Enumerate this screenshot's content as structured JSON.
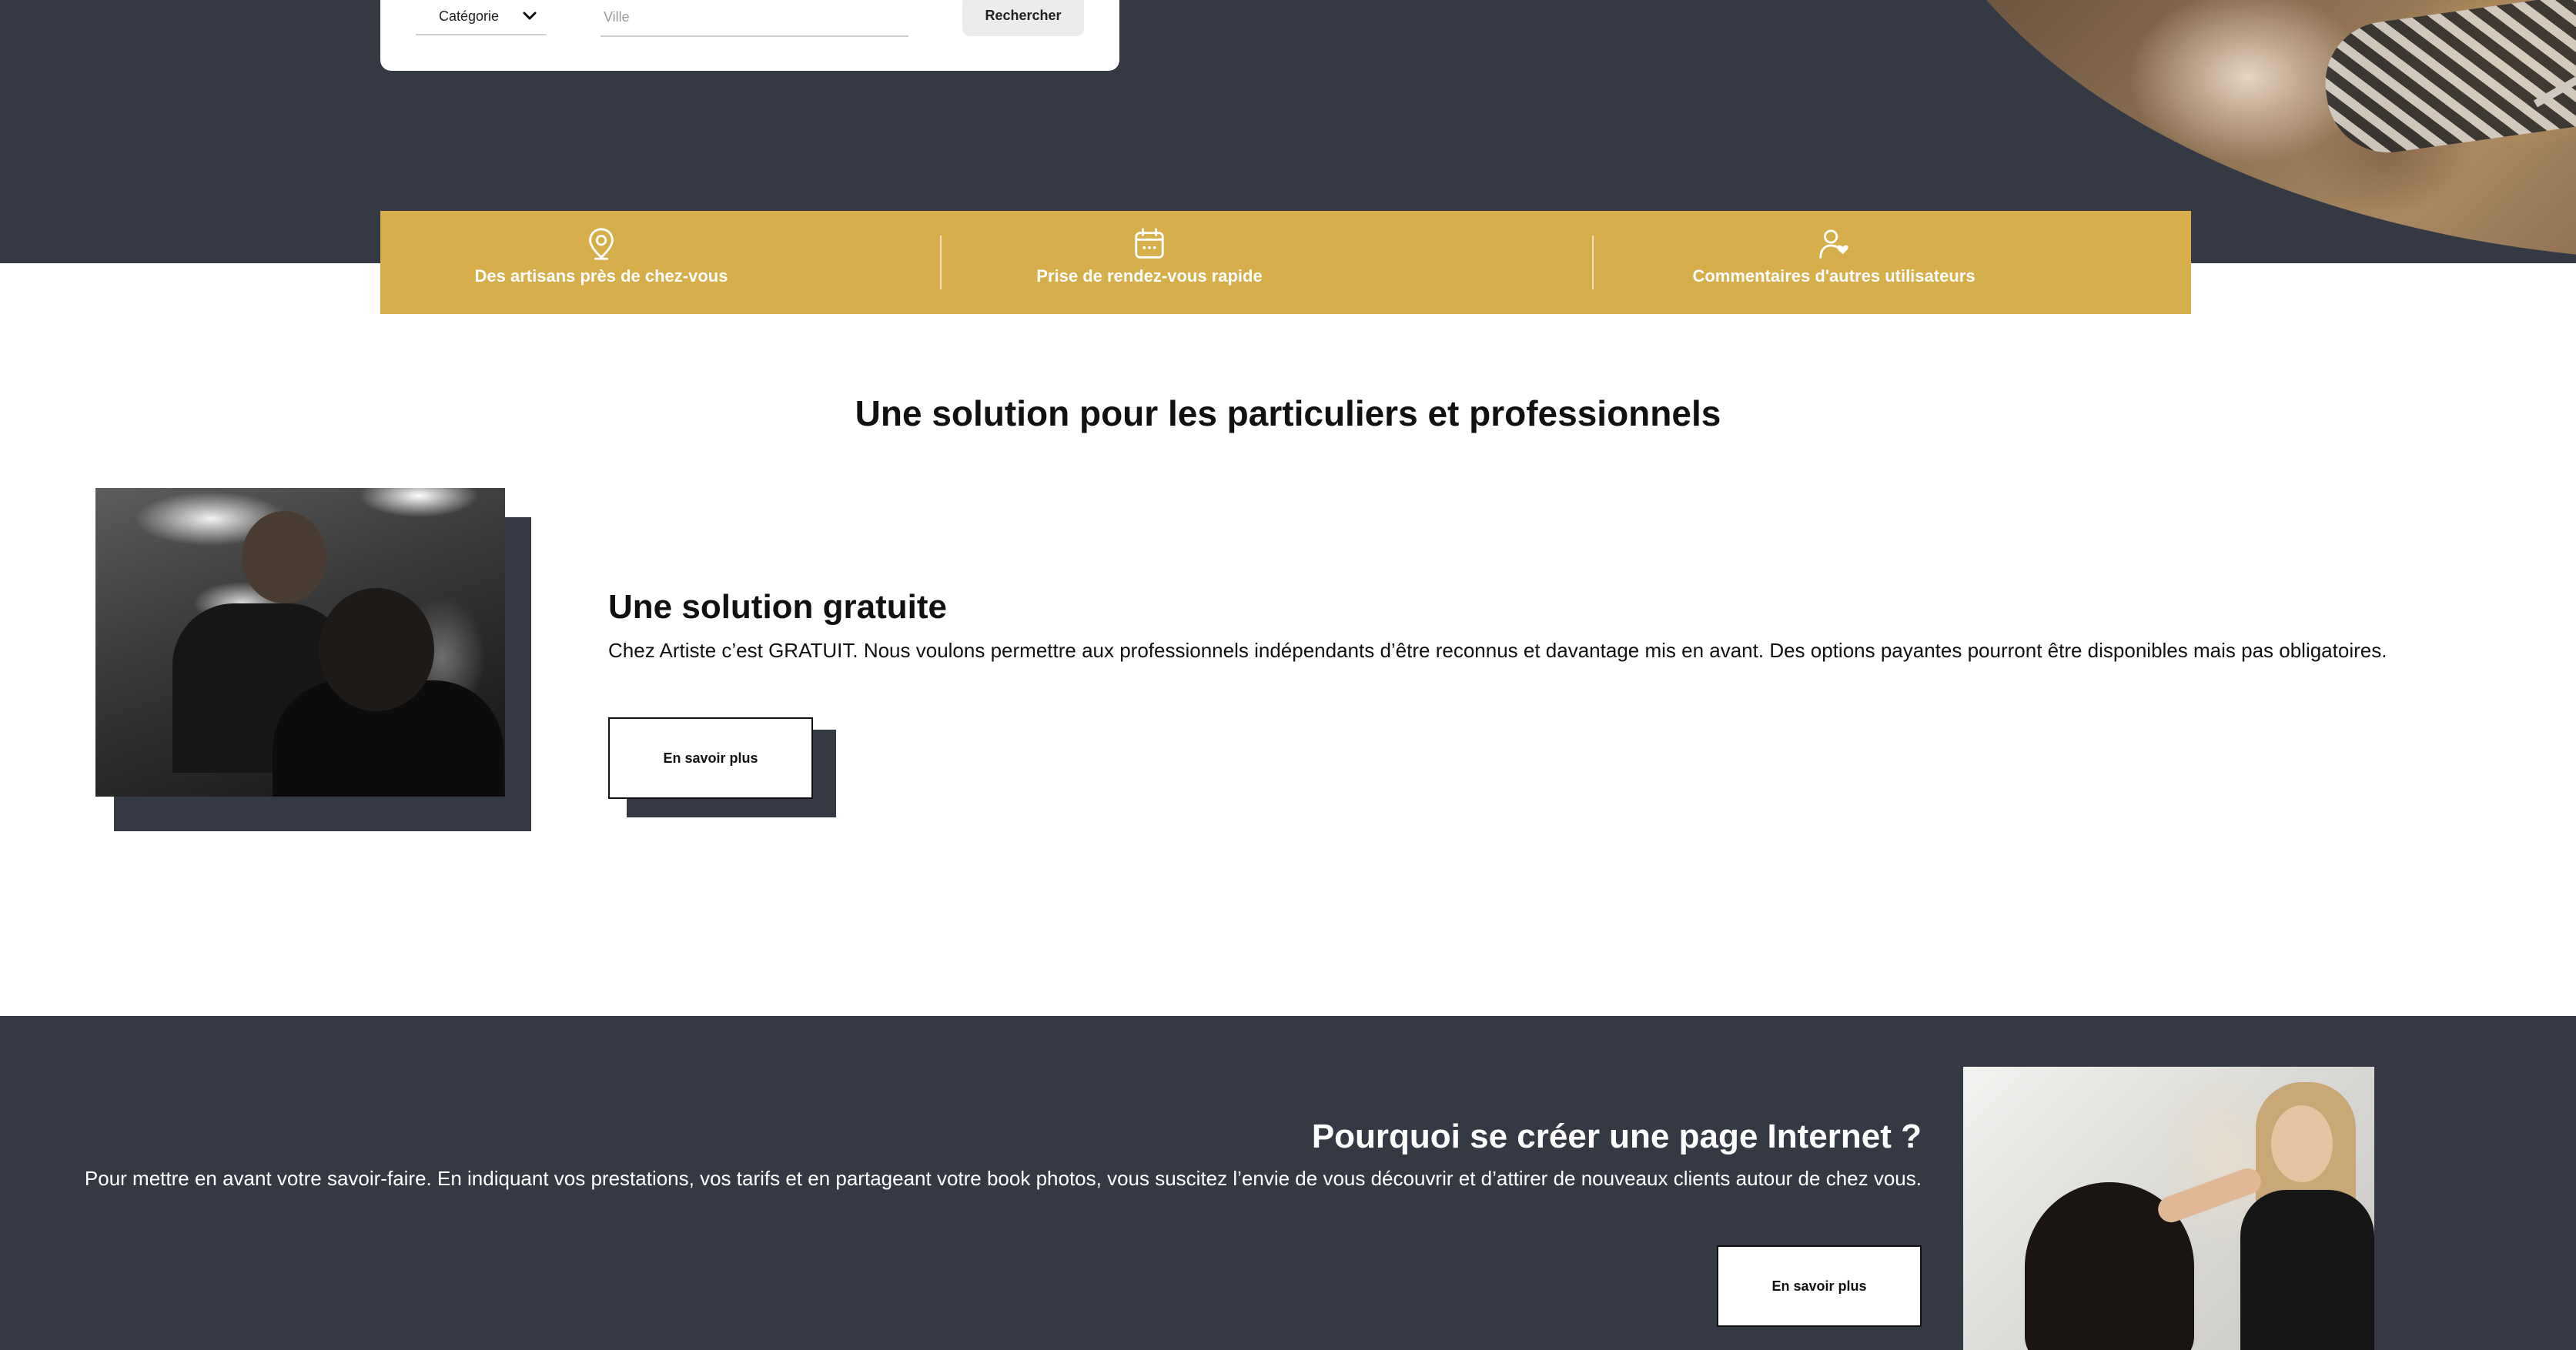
{
  "search": {
    "category_label": "Catégorie",
    "city_placeholder": "Ville",
    "submit_label": "Rechercher"
  },
  "features": [
    {
      "icon": "location-pin-icon",
      "label": "Des artisans près de chez-vous"
    },
    {
      "icon": "calendar-icon",
      "label": "Prise de rendez-vous rapide"
    },
    {
      "icon": "user-heart-icon",
      "label": "Commentaires d'autres utilisateurs"
    }
  ],
  "section1": {
    "title": "Une solution pour les particuliers et professionnels",
    "heading": "Une solution gratuite",
    "text": "Chez Artiste c’est GRATUIT. Nous voulons permettre aux professionnels indépendants d’être reconnus et davantage mis en avant. Des options payantes pourront être disponibles mais pas obligatoires.",
    "button_label": "En savoir plus"
  },
  "section2": {
    "heading": "Pourquoi se créer une page Internet ?",
    "text": "Pour mettre en avant votre savoir-faire. En indiquant vos prestations, vos tarifs et en partageant votre book photos, vous suscitez l’envie de vous découvrir et d’attirer de nouveaux clients autour de chez vous.",
    "button_label": "En savoir plus"
  },
  "colors": {
    "dark": "#353944",
    "gold": "#d6ae4a",
    "white": "#ffffff"
  }
}
